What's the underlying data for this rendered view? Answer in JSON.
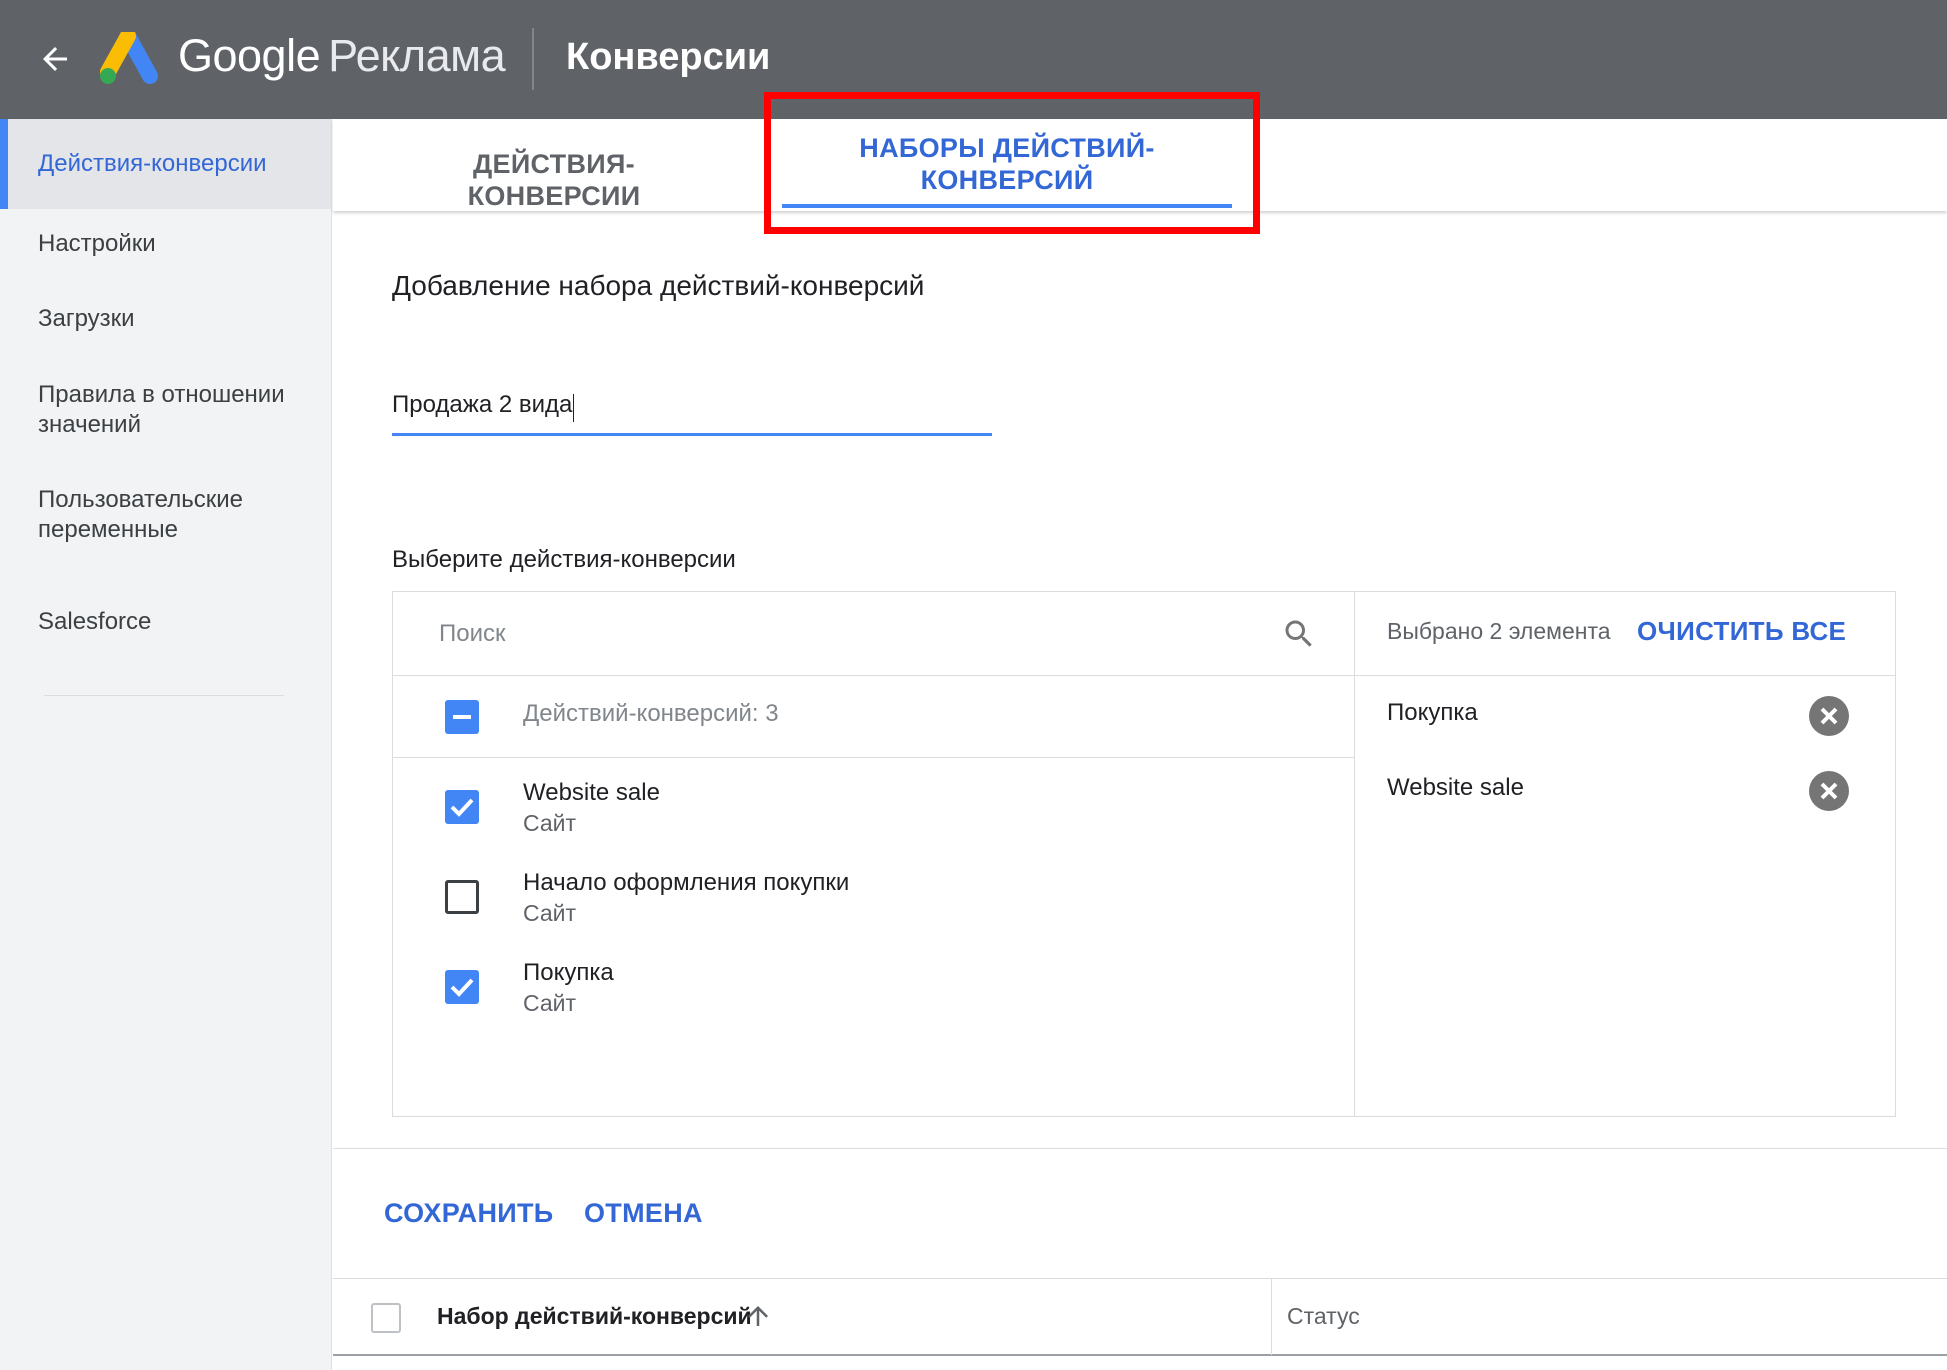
{
  "header": {
    "brand_google": "Google",
    "brand_product": "Реклама",
    "title": "Конверсии",
    "back_icon": "arrow-back-icon",
    "logo_icon": "google-ads-logo"
  },
  "sidebar": {
    "items": [
      {
        "label": "Действия-конверсии",
        "active": true
      },
      {
        "label": "Настройки"
      },
      {
        "label": "Загрузки"
      },
      {
        "label": "Правила в отношении значений"
      },
      {
        "label": "Пользовательские переменные"
      },
      {
        "label": "Salesforce"
      }
    ]
  },
  "tabs": [
    {
      "label": "ДЕЙСТВИЯ-КОНВЕРСИИ",
      "active": false
    },
    {
      "label": "НАБОРЫ ДЕЙСТВИЙ-КОНВЕРСИЙ",
      "active": true
    }
  ],
  "form": {
    "section_title": "Добавление набора действий-конверсий",
    "name_value": "Продажа 2 вида",
    "select_label": "Выберите действия-конверсии"
  },
  "picker": {
    "search_placeholder": "Поиск",
    "all_label": "Действий-конверсий: 3",
    "items": [
      {
        "title": "Website sale",
        "sub": "Сайт",
        "checked": true
      },
      {
        "title": "Начало оформления покупки",
        "sub": "Сайт",
        "checked": false
      },
      {
        "title": "Покупка",
        "sub": "Сайт",
        "checked": true
      }
    ],
    "selected_count": "Выбрано 2 элемента",
    "clear_all": "ОЧИСТИТЬ ВСЕ",
    "selected": [
      "Покупка",
      "Website sale"
    ]
  },
  "actions": {
    "save": "СОХРАНИТЬ",
    "cancel": "ОТМЕНА"
  },
  "table": {
    "col_name": "Набор действий-конверсий",
    "col_status": "Статус"
  },
  "colors": {
    "header_bg": "#5f6368",
    "accent": "#3367d6",
    "checkbox": "#4285f4",
    "highlight": "#ff0000"
  }
}
